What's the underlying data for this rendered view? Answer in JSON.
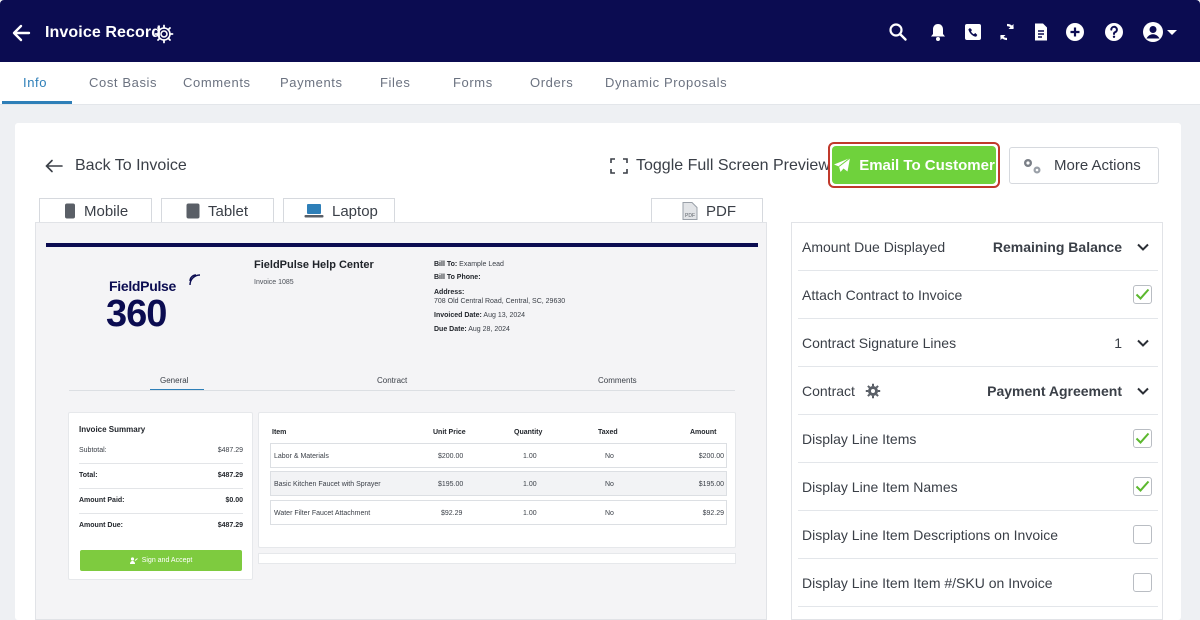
{
  "header": {
    "title": "Invoice Record",
    "icons": [
      "back-arrow-icon",
      "gear-icon",
      "search-icon",
      "bell-icon",
      "phone-icon",
      "sync-icon",
      "document-icon",
      "plus-circle-icon",
      "help-icon",
      "user-icon"
    ]
  },
  "tabs": [
    {
      "label": "Info",
      "active": true
    },
    {
      "label": "Cost Basis"
    },
    {
      "label": "Comments"
    },
    {
      "label": "Payments"
    },
    {
      "label": "Files"
    },
    {
      "label": "Forms"
    },
    {
      "label": "Orders"
    },
    {
      "label": "Dynamic Proposals"
    }
  ],
  "toolbar": {
    "back_label": "Back To Invoice",
    "fullscreen_label": "Toggle Full Screen Preview",
    "email_label": "Email To Customer",
    "more_label": "More Actions"
  },
  "devices": [
    {
      "label": "Mobile"
    },
    {
      "label": "Tablet"
    },
    {
      "label": "Laptop"
    },
    {
      "label": "PDF"
    }
  ],
  "invoice": {
    "logo_top": "FieldPulse",
    "logo_num": "360",
    "company": "FieldPulse Help Center",
    "number": "Invoice 1085",
    "bill_to_label": "Bill To:",
    "bill_to": "Example Lead",
    "bill_phone_label": "Bill To Phone:",
    "address_label": "Address:",
    "address": "708 Old Central Road, Central, SC, 29630",
    "invoiced_label": "Invoiced Date:",
    "invoiced_date": "Aug 13, 2024",
    "due_label": "Due Date:",
    "due_date": "Aug 28, 2024",
    "subtabs": [
      "General",
      "Contract",
      "Comments"
    ],
    "summary": {
      "title": "Invoice Summary",
      "subtotal_label": "Subtotal:",
      "subtotal": "$487.29",
      "total_label": "Total:",
      "total": "$487.29",
      "paid_label": "Amount Paid:",
      "paid": "$0.00",
      "due_label": "Amount Due:",
      "due": "$487.29",
      "sign_label": "Sign and Accept"
    },
    "items_headers": [
      "Item",
      "Unit Price",
      "Quantity",
      "Taxed",
      "Amount"
    ],
    "items": [
      {
        "item": "Labor & Materials",
        "unit_price": "$200.00",
        "quantity": "1.00",
        "taxed": "No",
        "amount": "$200.00"
      },
      {
        "item": "Basic Kitchen Faucet with Sprayer",
        "unit_price": "$195.00",
        "quantity": "1.00",
        "taxed": "No",
        "amount": "$195.00"
      },
      {
        "item": "Water Filter Faucet Attachment",
        "unit_price": "$92.29",
        "quantity": "1.00",
        "taxed": "No",
        "amount": "$92.29"
      }
    ]
  },
  "settings": [
    {
      "label": "Amount Due Displayed",
      "value": "Remaining Balance",
      "control": "dropdown"
    },
    {
      "label": "Attach Contract to Invoice",
      "control": "checkbox",
      "checked": true
    },
    {
      "label": "Contract Signature Lines",
      "value": "1",
      "control": "dropdown"
    },
    {
      "label": "Contract",
      "value": "Payment Agreement",
      "control": "dropdown",
      "gear": true
    },
    {
      "label": "Display Line Items",
      "control": "checkbox",
      "checked": true
    },
    {
      "label": "Display Line Item Names",
      "control": "checkbox",
      "checked": true
    },
    {
      "label": "Display Line Item Descriptions on Invoice",
      "control": "checkbox",
      "checked": false
    },
    {
      "label": "Display Line Item Item #/SKU on Invoice",
      "control": "checkbox",
      "checked": false
    }
  ],
  "colors": {
    "header_bg": "#0b0c51",
    "accent": "#2e7fb8",
    "email_green": "#6fd23c",
    "highlight_red": "#c0392b",
    "check_green": "#5cb82e"
  }
}
